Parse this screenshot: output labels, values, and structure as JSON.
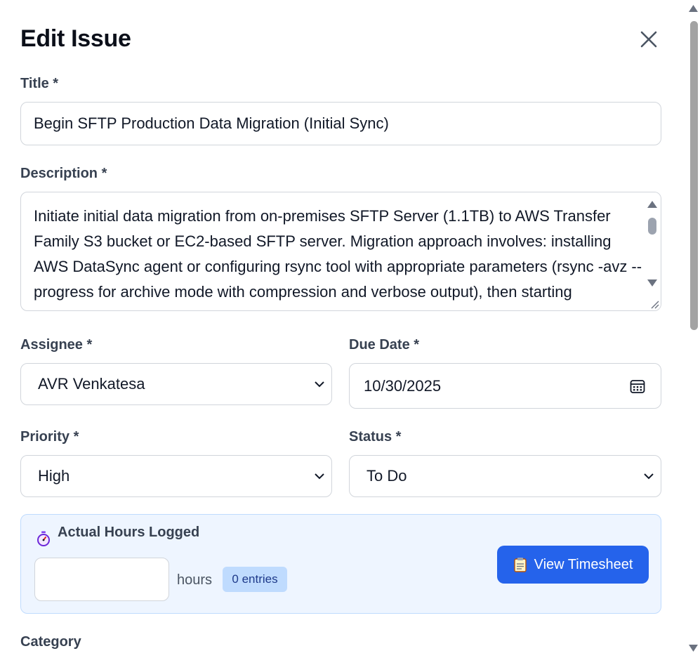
{
  "modal": {
    "title": "Edit Issue",
    "close_icon": "close-icon"
  },
  "form": {
    "title_label": "Title *",
    "title_value": "Begin SFTP Production Data Migration (Initial Sync)",
    "description_label": "Description *",
    "description_value": "Initiate initial data migration from on-premises SFTP Server (1.1TB) to AWS Transfer Family S3 bucket or EC2-based SFTP server. Migration approach involves: installing AWS DataSync agent or configuring rsync tool with appropriate parameters (rsync -avz --progress for archive mode with compression and verbose output), then starting incremental SFTP",
    "assignee_label": "Assignee *",
    "assignee_value": "AVR Venkatesa",
    "due_date_label": "Due Date *",
    "due_date_value": "10/30/2025",
    "priority_label": "Priority *",
    "priority_value": "High",
    "status_label": "Status *",
    "status_value": "To Do",
    "category_label": "Category"
  },
  "hours": {
    "title": "Actual Hours Logged",
    "input_value": "",
    "unit": "hours",
    "entries_badge": "0 entries",
    "view_timesheet_label": "View Timesheet",
    "icons": [
      "stopwatch-icon",
      "clipboard-icon",
      "calendar-icon",
      "chevron-down-icon"
    ]
  },
  "colors": {
    "accent": "#2563eb",
    "panel_bg": "#eef5ff",
    "badge_bg": "#bfdbfe"
  }
}
